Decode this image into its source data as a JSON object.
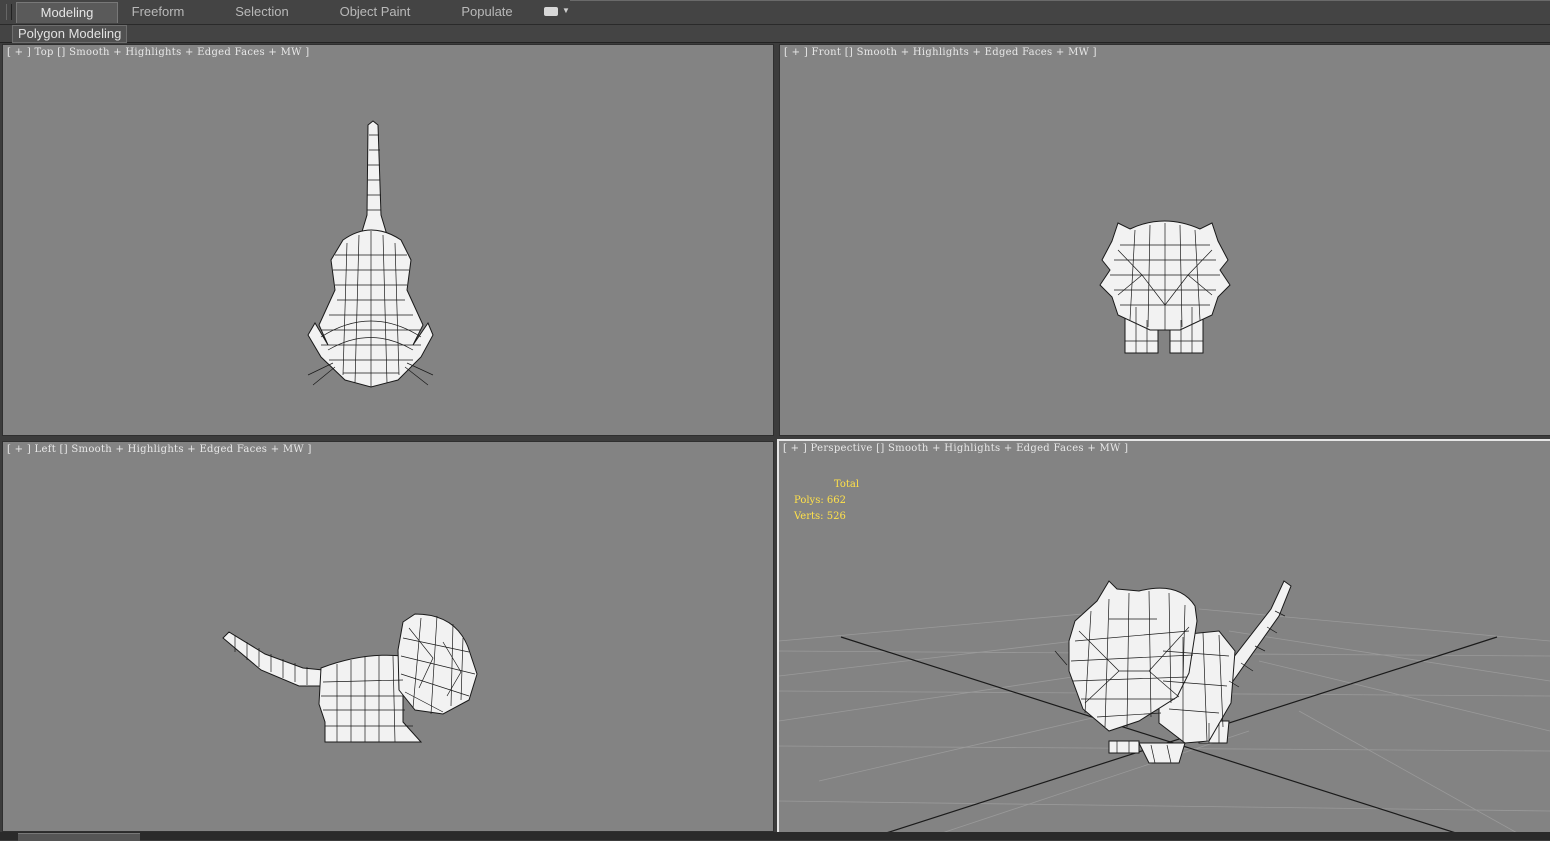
{
  "ribbon": {
    "tabs": [
      {
        "label": "Modeling",
        "active": true
      },
      {
        "label": "Freeform"
      },
      {
        "label": "Selection"
      },
      {
        "label": "Object Paint"
      },
      {
        "label": "Populate"
      }
    ],
    "panel_label": "Polygon Modeling"
  },
  "viewports": {
    "top": {
      "bracket_open": "[ + ] ",
      "view": "Top",
      "shading": "Smooth + Highlights + Edged Faces + MW",
      "bracket_close": " ]"
    },
    "front": {
      "bracket_open": "[ + ] ",
      "view": "Front",
      "shading": "Smooth + Highlights + Edged Faces + MW",
      "bracket_close": " ]"
    },
    "left": {
      "bracket_open": "[ + ] ",
      "view": "Left",
      "shading": "Smooth + Highlights + Edged Faces + MW",
      "bracket_close": " ]"
    },
    "perspective": {
      "bracket_open": "[ + ] ",
      "view": "Perspective",
      "shading": "Smooth + Highlights + Edged Faces + MW",
      "bracket_close": " ]"
    }
  },
  "stats": {
    "header": "Total",
    "polys_label": "Polys:",
    "polys_value": "662",
    "verts_label": "Verts:",
    "verts_value": "526"
  },
  "colors": {
    "viewport_bg": "#838383",
    "stats_text": "#ffe14a",
    "active_border": "#e6e6e6"
  }
}
